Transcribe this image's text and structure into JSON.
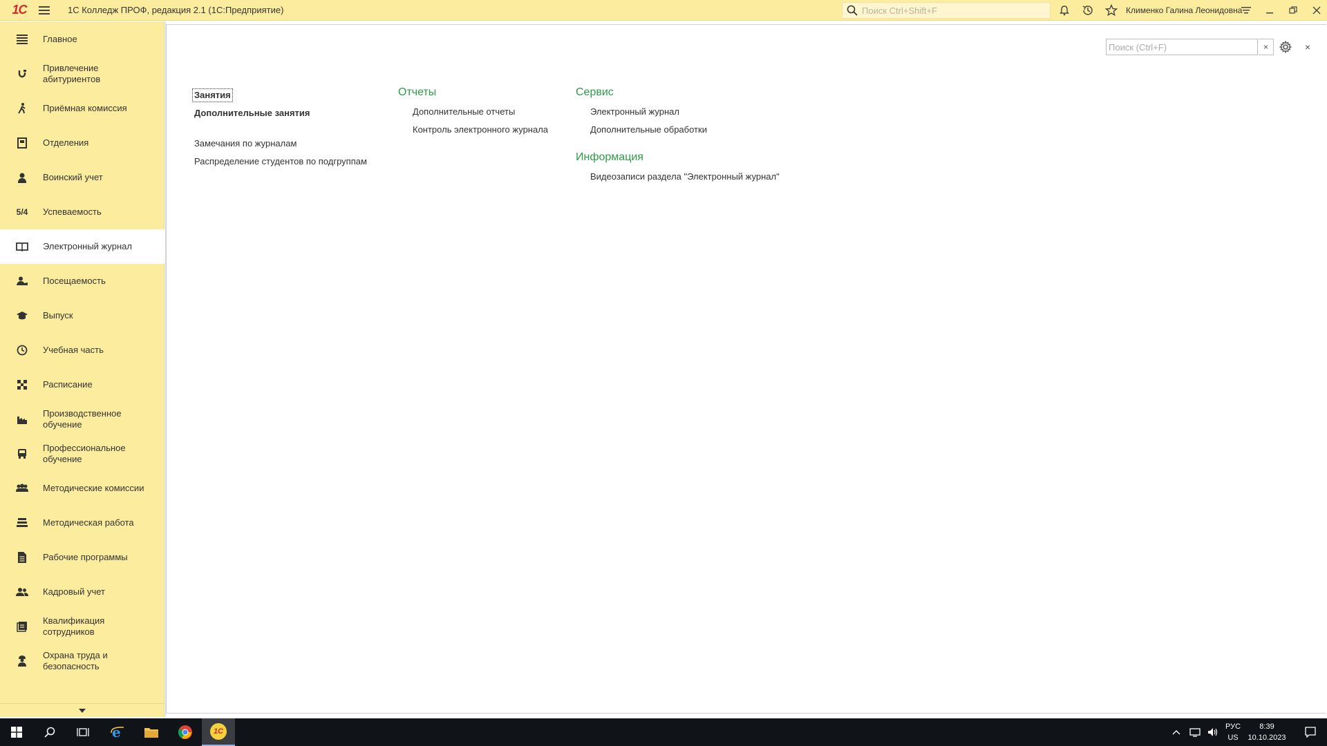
{
  "titlebar": {
    "logo": "1С",
    "app_title": "1С Колледж ПРОФ, редакция 2.1  (1С:Предприятие)",
    "search_placeholder": "Поиск Ctrl+Shift+F",
    "user": "Клименко Галина Леонидовна"
  },
  "sidebar": {
    "items": [
      {
        "label": "Главное",
        "icon": "list-icon"
      },
      {
        "label": "Привлечение абитуриентов",
        "icon": "magnet-icon"
      },
      {
        "label": "Приёмная комиссия",
        "icon": "walking-person-icon"
      },
      {
        "label": "Отделения",
        "icon": "building-icon"
      },
      {
        "label": "Воинский учет",
        "icon": "soldier-icon"
      },
      {
        "label": "Успеваемость",
        "icon": "grades-icon"
      },
      {
        "label": "Электронный журнал",
        "icon": "book-icon"
      },
      {
        "label": "Посещаемость",
        "icon": "attendance-icon"
      },
      {
        "label": "Выпуск",
        "icon": "graduation-cap-icon"
      },
      {
        "label": "Учебная часть",
        "icon": "clock-icon"
      },
      {
        "label": "Расписание",
        "icon": "schedule-icon"
      },
      {
        "label": "Производственное обучение",
        "icon": "factory-icon"
      },
      {
        "label": "Профессиональное обучение",
        "icon": "bus-icon"
      },
      {
        "label": "Методические комиссии",
        "icon": "group-icon"
      },
      {
        "label": "Методическая работа",
        "icon": "stack-icon"
      },
      {
        "label": "Рабочие программы",
        "icon": "document-icon"
      },
      {
        "label": "Кадровый учет",
        "icon": "people-icon"
      },
      {
        "label": "Квалификация сотрудников",
        "icon": "certificate-icon"
      },
      {
        "label": "Охрана труда и безопасность",
        "icon": "worker-icon"
      }
    ],
    "active_index": 6,
    "grades_glyph": "5/4"
  },
  "main": {
    "search_placeholder": "Поиск (Ctrl+F)",
    "clear_label": "×",
    "close_label": "×",
    "col1": {
      "links": [
        "Занятия",
        "Дополнительные занятия",
        "Замечания по журналам",
        "Распределение студентов по подгруппам"
      ]
    },
    "reports": {
      "title": "Отчеты",
      "links": [
        "Дополнительные отчеты",
        "Контроль электронного журнала"
      ]
    },
    "service": {
      "title": "Сервис",
      "links": [
        "Электронный журнал",
        "Дополнительные обработки"
      ]
    },
    "info": {
      "title": "Информация",
      "links": [
        "Видеозаписи раздела \"Электронный журнал\""
      ]
    }
  },
  "taskbar": {
    "lang": "РУС",
    "layout": "US",
    "time": "8:39",
    "date": "10.10.2023",
    "app_label": "1С"
  }
}
